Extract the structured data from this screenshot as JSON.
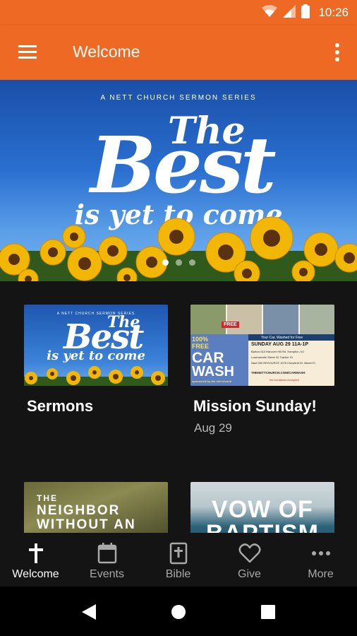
{
  "status_bar": {
    "time": "10:26",
    "icons": [
      "wifi-icon",
      "signal-icon",
      "battery-icon"
    ]
  },
  "app_bar": {
    "title": "Welcome",
    "menu_icon": "hamburger-menu-icon",
    "overflow_icon": "more-vert-icon",
    "color": "#ee6a24"
  },
  "hero": {
    "kicker": "A NETT CHURCH SERMON SERIES",
    "title_the": "The",
    "title_best": "Best",
    "title_sub": "is yet to come",
    "page_count": 3,
    "active_page": 1
  },
  "cards": [
    {
      "title": "Sermons",
      "subtitle": "",
      "thumb": {
        "kicker": "A NETT CHURCH SERMON SERIES",
        "the": "The",
        "best": "Best",
        "sub": "is yet to come"
      }
    },
    {
      "title": "Mission Sunday!",
      "subtitle": "Aug 29",
      "thumb": {
        "free_badge": "FREE",
        "percent": "100%",
        "free": "FREE",
        "car": "CAR",
        "wash": "WASH",
        "sponsor": "sponsored by the nett church",
        "header": "Your Car, Washed for Free",
        "date": "SUNDAY AUG 29 11A-1P",
        "locations": [
          "Barlow 510 Hanover Hill Rd. Hampton, NJ",
          "Lowmanville Street 32 Tracker St",
          "Nauf 300 RESOURCE 1575 Cheyfield Dr. Miami FL"
        ],
        "site": "THENETTCHURCH.COM/CARWASH",
        "note": "No Donations Accepted"
      }
    },
    {
      "title": "",
      "subtitle": "",
      "thumb": {
        "line1": "THE",
        "line2": "NEIGHBOR",
        "line3": "WITHOUT AN"
      }
    },
    {
      "title": "",
      "subtitle": "",
      "thumb": {
        "line1": "VOW OF",
        "line2": "BAPTISM"
      }
    }
  ],
  "bottom_nav": [
    {
      "label": "Welcome",
      "icon": "cross-icon",
      "active": true
    },
    {
      "label": "Events",
      "icon": "calendar-icon",
      "active": false
    },
    {
      "label": "Bible",
      "icon": "bible-icon",
      "active": false
    },
    {
      "label": "Give",
      "icon": "heart-icon",
      "active": false
    },
    {
      "label": "More",
      "icon": "more-horiz-icon",
      "active": false
    }
  ],
  "system_nav": [
    "back-icon",
    "home-icon",
    "recents-icon"
  ]
}
